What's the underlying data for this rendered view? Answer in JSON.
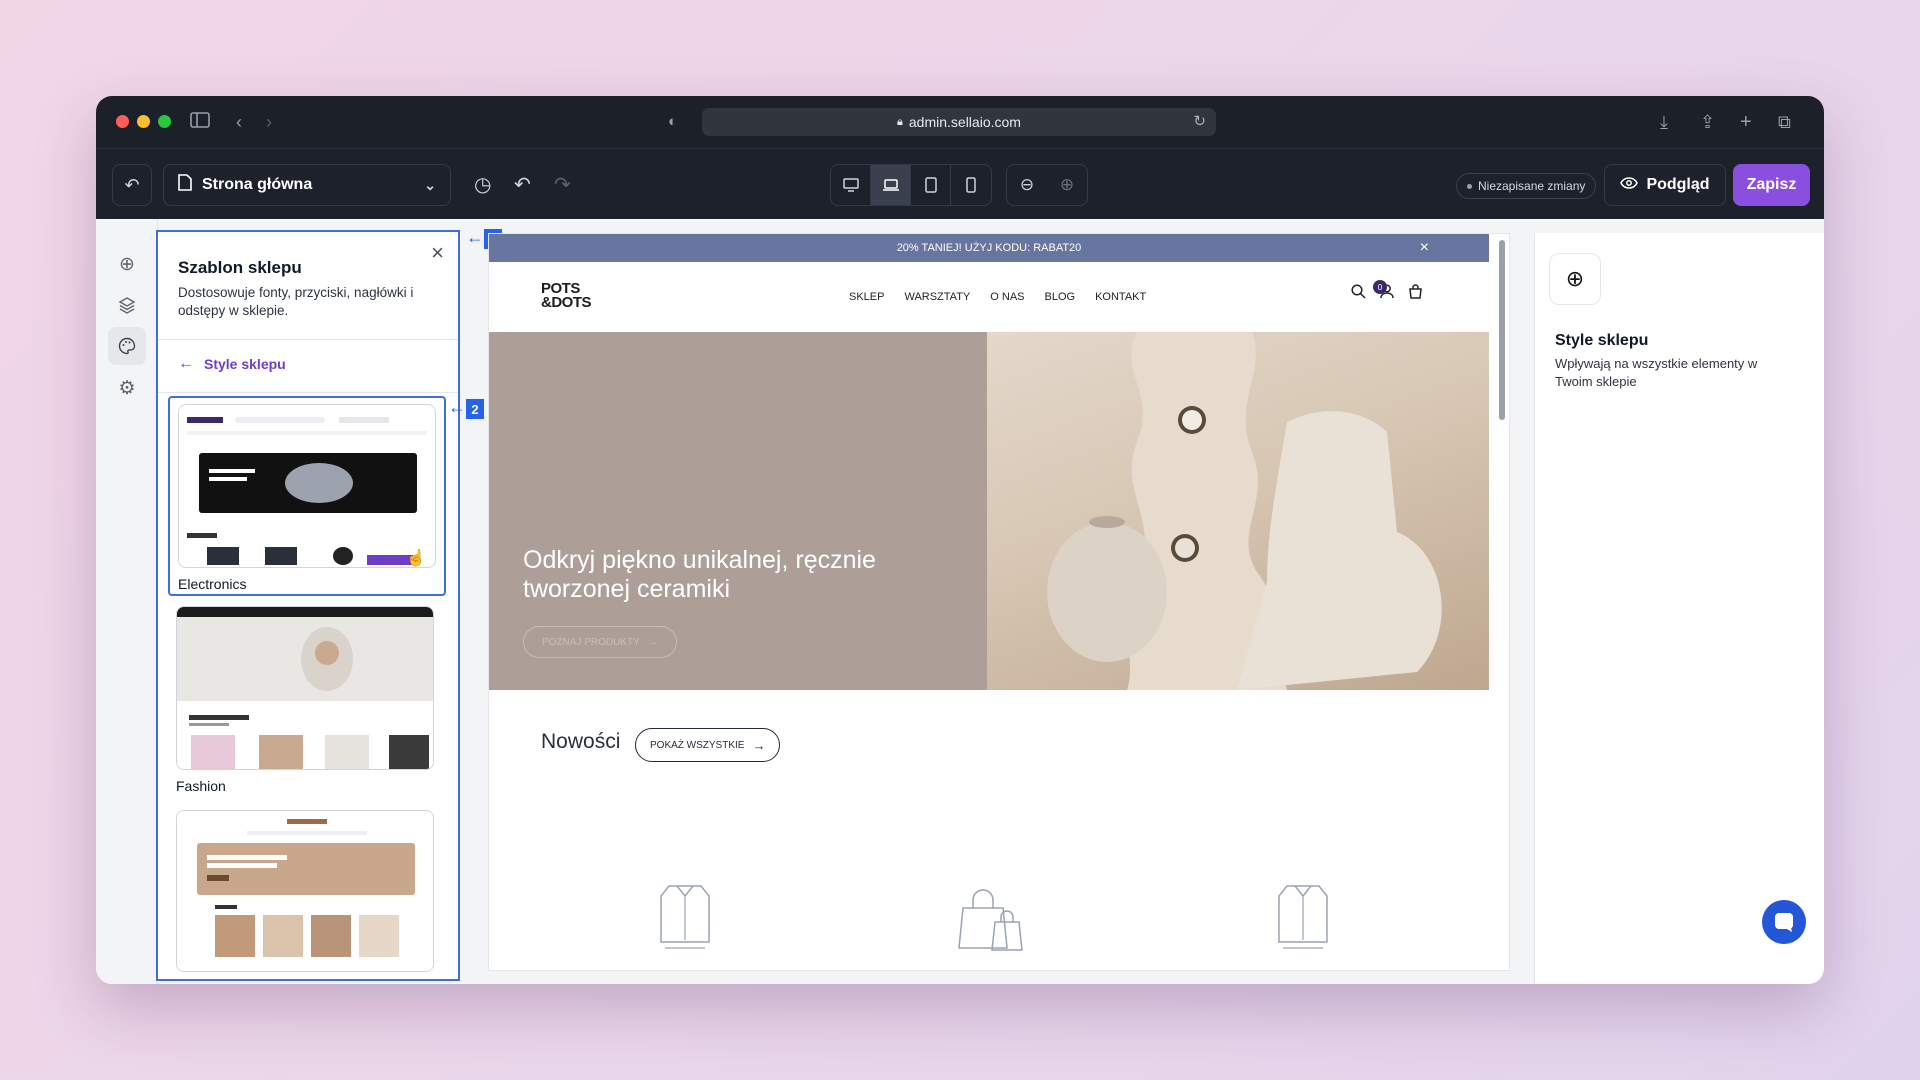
{
  "browser": {
    "url": "admin.sellaio.com",
    "traffic_colors": [
      "#ff5f57",
      "#febc2e",
      "#28c840"
    ]
  },
  "toolbar": {
    "page_name": "Strona główna",
    "unsaved_label": "Niezapisane zmiany",
    "preview_label": "Podgląd",
    "save_label": "Zapisz",
    "accent_color": "#8b4fe0"
  },
  "sidebar": {
    "title": "Szablon sklepu",
    "description": "Dostosowuje fonty, przyciski, nagłówki i odstępy w sklepie.",
    "back_label": "Style sklepu",
    "templates": [
      {
        "label": "Electronics",
        "selected": true
      },
      {
        "label": "Fashion",
        "selected": false
      },
      {
        "label": "",
        "selected": false
      }
    ],
    "markers": [
      "1",
      "2"
    ]
  },
  "site": {
    "promo": "20% TANIEJ! UŻYJ KODU: RABAT20",
    "logo_line1": "POTS",
    "logo_line2": "&DOTS",
    "nav": [
      "SKLEP",
      "WARSZTATY",
      "O NAS",
      "BLOG",
      "KONTAKT"
    ],
    "cart_count": "0",
    "hero_title": "Odkryj piękno unikalnej, ręcznie tworzonej ceramiki",
    "hero_button": "POZNAJ PRODUKTY",
    "new_title": "Nowości",
    "new_button": "POKAŻ WSZYSTKIE"
  },
  "right_panel": {
    "title": "Style sklepu",
    "description": "Wpływają na wszystkie elementy w Twoim sklepie"
  }
}
